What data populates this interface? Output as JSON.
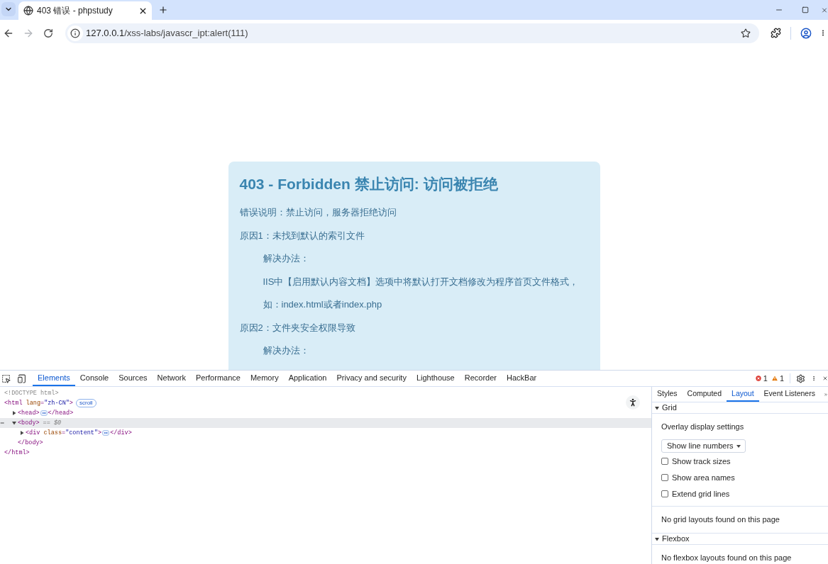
{
  "browser": {
    "tab_strip": {
      "tabs": [
        {
          "title": "403 错误 - phpstudy",
          "selected": true
        }
      ]
    },
    "toolbar": {
      "nav_buttons": [
        {
          "kind": "back",
          "disabled": false
        },
        {
          "kind": "forward",
          "disabled": true
        },
        {
          "kind": "reload",
          "disabled": false
        }
      ],
      "url": {
        "host": "127.0.0.1",
        "path": "/xss-labs/javascr_ipt:alert(111)"
      },
      "bookmarked": false
    }
  },
  "page": {
    "card": {
      "title": "403 - Forbidden 禁止访问: 访问被拒绝",
      "lines": [
        {
          "text": "错误说明：禁止访问，服务器拒绝访问",
          "indented": false
        },
        {
          "text": "原因1：未找到默认的索引文件",
          "indented": false
        },
        {
          "text": "解决办法：",
          "indented": true
        },
        {
          "text": "IIS中【启用默认内容文档】选项中将默认打开文档修改为程序首页文件格式，",
          "indented": true
        },
        {
          "text": "如：index.html或者index.php",
          "indented": true
        },
        {
          "text": "原因2：文件夹安全权限导致",
          "indented": false
        },
        {
          "text": "解决办法：",
          "indented": true
        }
      ]
    }
  },
  "devtools": {
    "tabs": [
      {
        "label": "Elements",
        "selected": true
      },
      {
        "label": "Console",
        "selected": false
      },
      {
        "label": "Sources",
        "selected": false
      },
      {
        "label": "Network",
        "selected": false
      },
      {
        "label": "Performance",
        "selected": false
      },
      {
        "label": "Memory",
        "selected": false
      },
      {
        "label": "Application",
        "selected": false
      },
      {
        "label": "Privacy and security",
        "selected": false
      },
      {
        "label": "Lighthouse",
        "selected": false
      },
      {
        "label": "Recorder",
        "selected": false
      },
      {
        "label": "HackBar",
        "selected": false
      }
    ],
    "errors": "1",
    "warnings": "1",
    "elements": {
      "dom_tree": [
        {
          "selected": false,
          "segments": [
            {
              "kind": "doctype",
              "text": "<!DOCTYPE html>"
            }
          ]
        },
        {
          "selected": false,
          "segments": [
            {
              "kind": "tag",
              "text": "<html"
            },
            {
              "kind": "attr_name",
              "text": " lang"
            },
            {
              "kind": "tag",
              "text": "="
            },
            {
              "kind": "attr_value",
              "text": "\"zh-CN\""
            },
            {
              "kind": "tag",
              "text": ">"
            },
            {
              "kind": "badge",
              "text": "scroll"
            }
          ],
          "closing": [
            {
              "kind": "tag",
              "text": "</html>"
            }
          ],
          "children": [
            {
              "selected": false,
              "expanded": false,
              "segments": [
                {
                  "kind": "tag",
                  "text": "<head>"
                },
                {
                  "kind": "ellipsis"
                },
                {
                  "kind": "tag",
                  "text": "</head>"
                }
              ]
            },
            {
              "selected": true,
              "expanded": true,
              "segments": [
                {
                  "kind": "tag",
                  "text": "<body>"
                },
                {
                  "kind": "marker",
                  "text": "== $0"
                }
              ],
              "closing": [
                {
                  "kind": "tag",
                  "text": "</body>"
                }
              ],
              "children": [
                {
                  "selected": false,
                  "expanded": false,
                  "segments": [
                    {
                      "kind": "tag",
                      "text": "<div"
                    },
                    {
                      "kind": "attr_name",
                      "text": " class"
                    },
                    {
                      "kind": "tag",
                      "text": "="
                    },
                    {
                      "kind": "attr_value",
                      "text": "\"content\""
                    },
                    {
                      "kind": "tag",
                      "text": ">"
                    },
                    {
                      "kind": "ellipsis"
                    },
                    {
                      "kind": "tag",
                      "text": "</div>"
                    }
                  ]
                }
              ]
            }
          ]
        }
      ]
    },
    "sidebar": {
      "tabs": [
        {
          "label": "Styles",
          "selected": false
        },
        {
          "label": "Computed",
          "selected": false
        },
        {
          "label": "Layout",
          "selected": true
        },
        {
          "label": "Event Listeners",
          "selected": false
        }
      ],
      "sections": [
        {
          "title": "Grid",
          "expanded": true,
          "settings_label": "Overlay display settings",
          "select": {
            "value": "Show line numbers"
          },
          "options": [
            {
              "label": "Show track sizes",
              "checked": false
            },
            {
              "label": "Show area names",
              "checked": false
            },
            {
              "label": "Extend grid lines",
              "checked": false
            }
          ],
          "empty_message": "No grid layouts found on this page"
        },
        {
          "title": "Flexbox",
          "expanded": true,
          "empty_message": "No flexbox layouts found on this page"
        }
      ]
    }
  }
}
